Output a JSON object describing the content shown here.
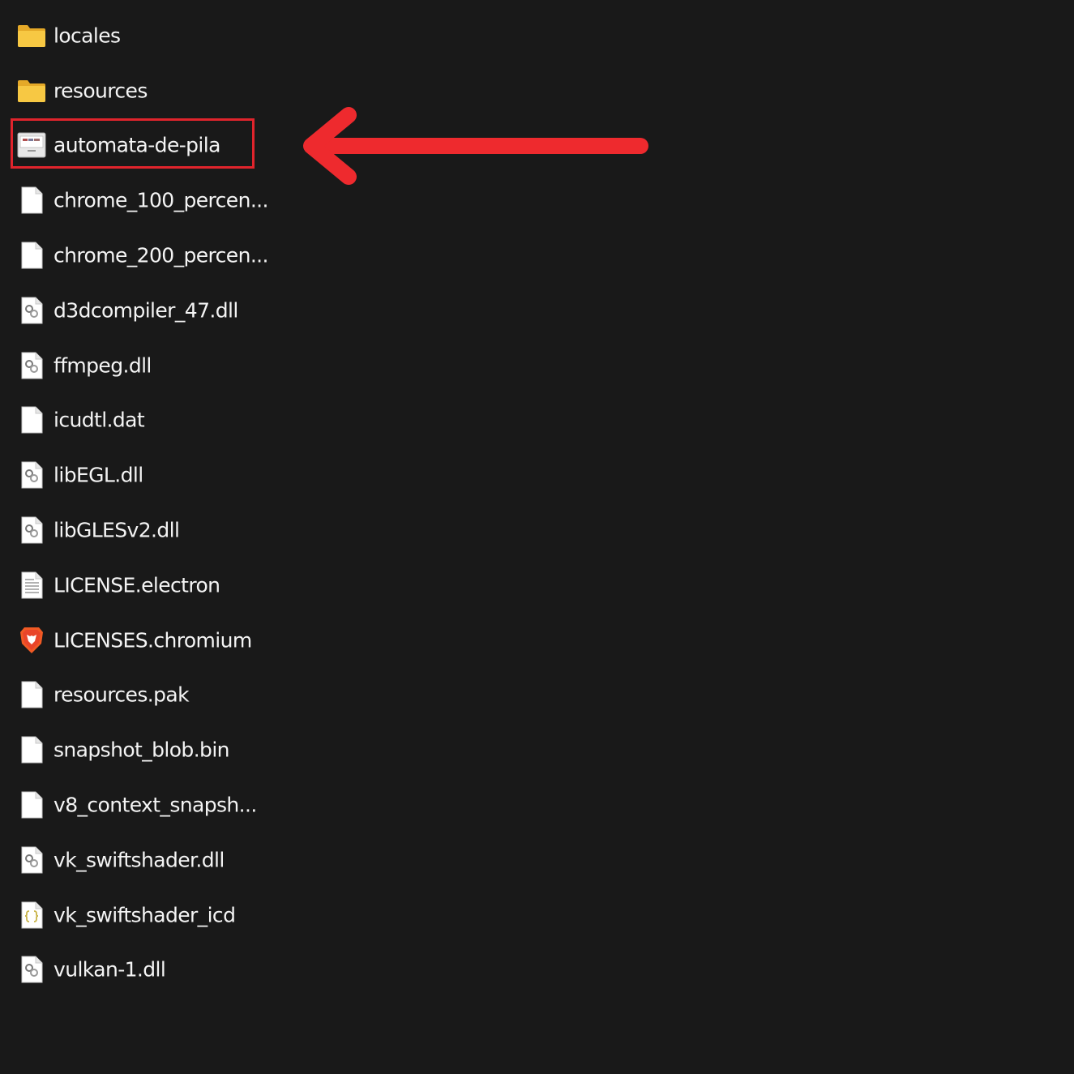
{
  "colors": {
    "background": "#191919",
    "text": "#f4f4f4",
    "highlight": "#e0242c",
    "arrow": "#ee2a2e",
    "folder": "#f5c43c"
  },
  "files": [
    {
      "name": "locales",
      "icon": "folder-icon"
    },
    {
      "name": "resources",
      "icon": "folder-icon"
    },
    {
      "name": "automata-de-pila",
      "icon": "app-icon",
      "highlighted": true
    },
    {
      "name": "chrome_100_percen...",
      "icon": "file-icon"
    },
    {
      "name": "chrome_200_percen...",
      "icon": "file-icon"
    },
    {
      "name": "d3dcompiler_47.dll",
      "icon": "dll-icon"
    },
    {
      "name": "ffmpeg.dll",
      "icon": "dll-icon"
    },
    {
      "name": "icudtl.dat",
      "icon": "file-icon"
    },
    {
      "name": "libEGL.dll",
      "icon": "dll-icon"
    },
    {
      "name": "libGLESv2.dll",
      "icon": "dll-icon"
    },
    {
      "name": "LICENSE.electron",
      "icon": "text-file-icon"
    },
    {
      "name": "LICENSES.chromium",
      "icon": "brave-icon"
    },
    {
      "name": "resources.pak",
      "icon": "file-icon"
    },
    {
      "name": "snapshot_blob.bin",
      "icon": "file-icon"
    },
    {
      "name": "v8_context_snapsh...",
      "icon": "file-icon"
    },
    {
      "name": "vk_swiftshader.dll",
      "icon": "dll-icon"
    },
    {
      "name": "vk_swiftshader_icd",
      "icon": "json-icon"
    },
    {
      "name": "vulkan-1.dll",
      "icon": "dll-icon"
    }
  ],
  "annotation": {
    "arrow_icon": "left-arrow-icon",
    "box": "highlight-box"
  }
}
